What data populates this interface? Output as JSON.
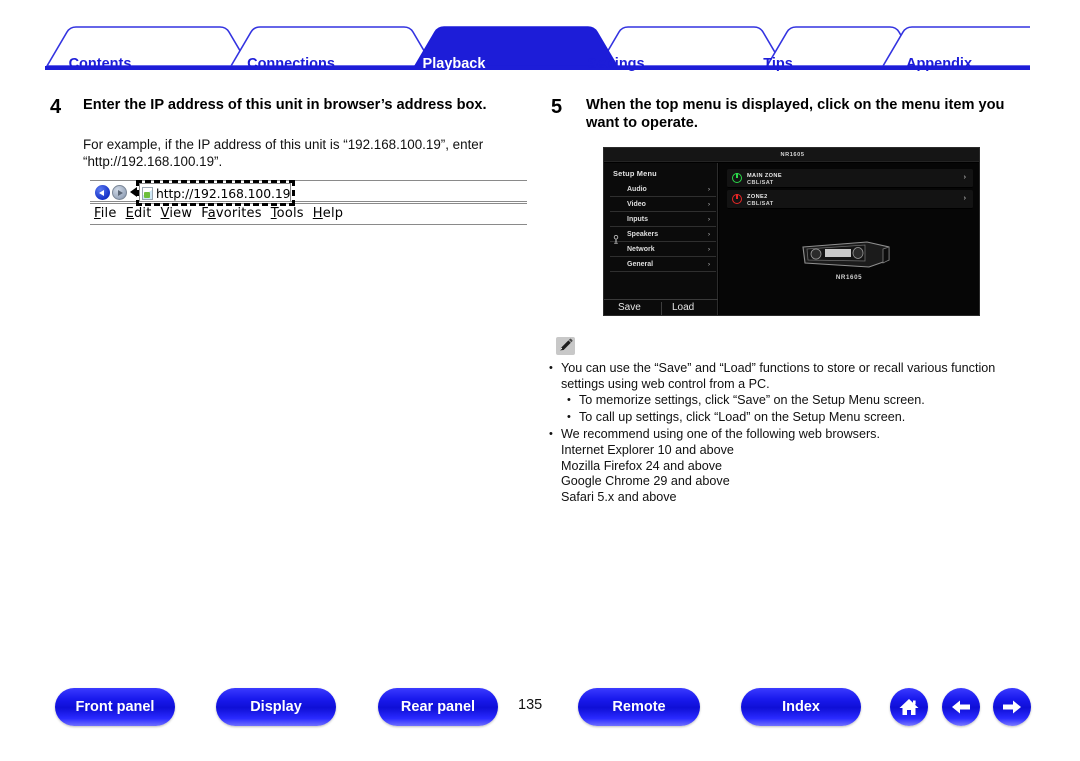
{
  "tabs": [
    {
      "label": "Contents",
      "active": false
    },
    {
      "label": "Connections",
      "active": false
    },
    {
      "label": "Playback",
      "active": true
    },
    {
      "label": "Settings",
      "active": false
    },
    {
      "label": "Tips",
      "active": false
    },
    {
      "label": "Appendix",
      "active": false
    }
  ],
  "colors": {
    "tab_accent": "#1d1dd8",
    "tab_active_bg": "#1d1dd8",
    "pill_blue": "#1a1aee",
    "power_on": "#2bd84a",
    "power_off": "#e82626"
  },
  "steps": [
    {
      "number": "4",
      "heading": "Enter the IP address of this unit in browser’s address box.",
      "body": "For example, if the IP address of this unit is “192.168.100.19”, enter “http://192.168.100.19”."
    },
    {
      "number": "5",
      "heading": "When the top menu is displayed, click on the menu item you want to operate."
    }
  ],
  "browser_mock": {
    "url_value": "http://192.168.100.19",
    "menu": [
      "File",
      "Edit",
      "View",
      "Favorites",
      "Tools",
      "Help"
    ],
    "menu_mnemonics": [
      "F",
      "E",
      "V",
      "a",
      "T",
      "H"
    ]
  },
  "setup_menu": {
    "titlebar": "NR1605",
    "panel_title": "Setup Menu",
    "items": [
      {
        "label": "Audio",
        "arrow": "›",
        "icon": null
      },
      {
        "label": "Video",
        "arrow": "›",
        "icon": null
      },
      {
        "label": "Inputs",
        "arrow": "›",
        "icon": null
      },
      {
        "label": "Speakers",
        "arrow": "›",
        "icon": "microphone-icon"
      },
      {
        "label": "Network",
        "arrow": "›",
        "icon": null
      },
      {
        "label": "General",
        "arrow": "›",
        "icon": null
      }
    ],
    "footer": {
      "save": "Save",
      "load": "Load"
    },
    "zones": [
      {
        "name": "MAIN ZONE",
        "source": "CBL/SAT",
        "power": "on",
        "arrow": "›"
      },
      {
        "name": "ZONE2",
        "source": "CBL/SAT",
        "power": "off",
        "arrow": "›"
      }
    ],
    "device_label": "NR1605"
  },
  "note": {
    "icon": "pencil-note-icon",
    "bullets": [
      {
        "level": 1,
        "text": "You can use the “Save” and “Load” functions to store or recall various function settings using web control from a PC."
      },
      {
        "level": 2,
        "text": "To memorize settings, click “Save” on the Setup Menu screen."
      },
      {
        "level": 2,
        "text": "To call up settings, click “Load” on the Setup Menu screen."
      },
      {
        "level": 1,
        "text": "We recommend using one of the following web browsers."
      },
      {
        "level": 0,
        "text": "Internet Explorer 10 and above"
      },
      {
        "level": 0,
        "text": "Mozilla Firefox 24 and above"
      },
      {
        "level": 0,
        "text": "Google Chrome 29 and above"
      },
      {
        "level": 0,
        "text": "Safari 5.x and above"
      }
    ]
  },
  "bottom_nav": {
    "page_number": "135",
    "buttons": [
      {
        "label": "Front panel"
      },
      {
        "label": "Display"
      },
      {
        "label": "Rear panel"
      },
      {
        "label": "Remote"
      },
      {
        "label": "Index"
      }
    ],
    "icons": [
      {
        "name": "home-icon"
      },
      {
        "name": "arrow-left-icon"
      },
      {
        "name": "arrow-right-icon"
      }
    ]
  }
}
